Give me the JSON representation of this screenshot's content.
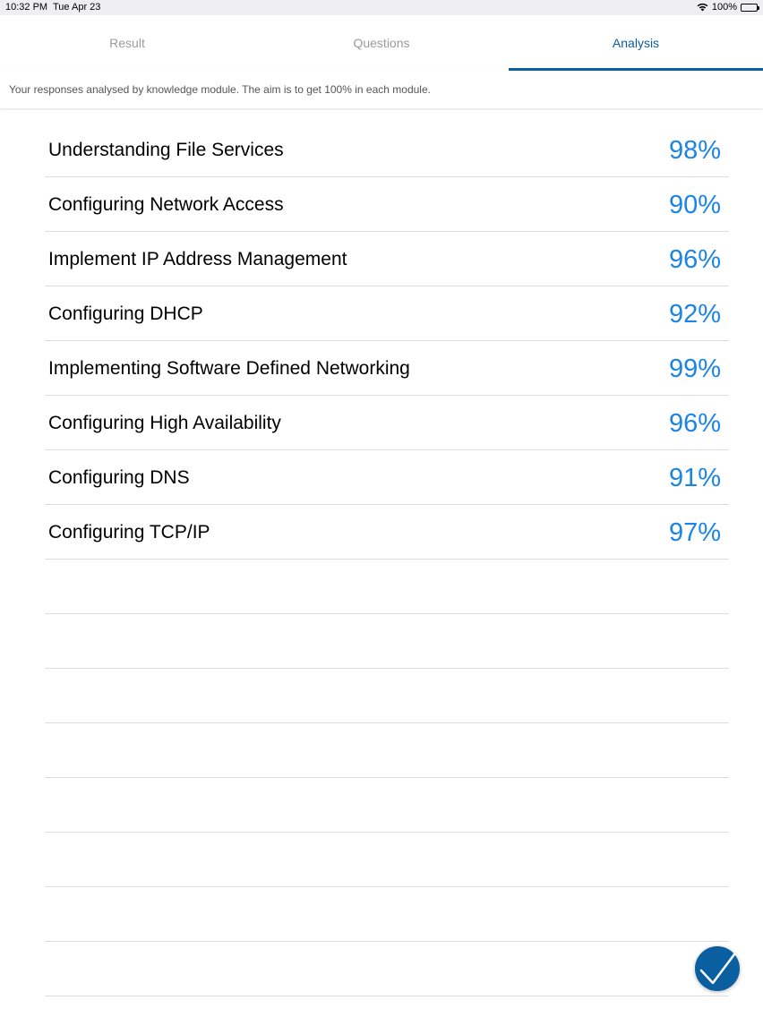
{
  "status_bar": {
    "time": "10:32 PM",
    "date": "Tue Apr 23",
    "battery": "100%"
  },
  "tabs": [
    {
      "label": "Result",
      "active": false
    },
    {
      "label": "Questions",
      "active": false
    },
    {
      "label": "Analysis",
      "active": true
    }
  ],
  "subtitle": "Your responses analysed by knowledge module. The aim is to get 100% in each module.",
  "modules": [
    {
      "name": "Understanding File Services",
      "score": "98%"
    },
    {
      "name": "Configuring Network Access",
      "score": "90%"
    },
    {
      "name": "Implement IP Address Management",
      "score": "96%"
    },
    {
      "name": "Configuring DHCP",
      "score": "92%"
    },
    {
      "name": "Implementing Software Defined Networking",
      "score": "99%"
    },
    {
      "name": "Configuring High Availability",
      "score": "96%"
    },
    {
      "name": "Configuring DNS",
      "score": "91%"
    },
    {
      "name": "Configuring TCP/IP",
      "score": "97%"
    }
  ],
  "empty_rows": 8,
  "fab": {
    "icon": "checkmark-icon"
  },
  "colors": {
    "accent": "#0a5fa0",
    "percent": "#1a85e6",
    "inactive_tab": "#9b9b9b"
  }
}
